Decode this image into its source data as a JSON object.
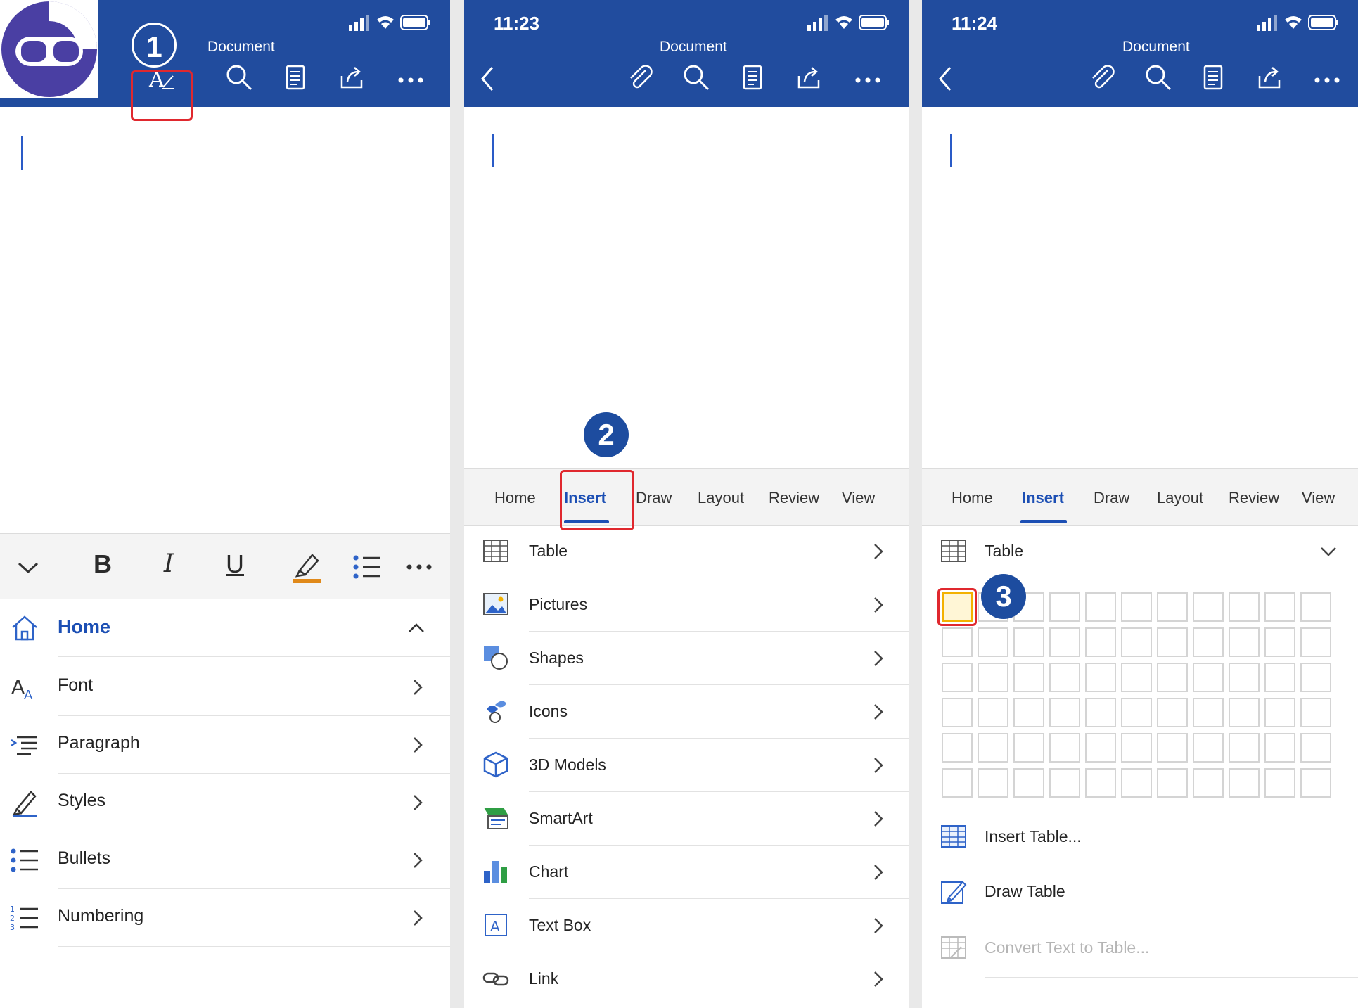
{
  "colors": {
    "brand": "#214c9e",
    "accent": "#1c4fb4",
    "highlight": "#e0282e",
    "badge": "#1d4c9f"
  },
  "panel1": {
    "title": "Document",
    "step": "1",
    "toolbar_icons": [
      "format-text-icon",
      "search-icon",
      "notes-icon",
      "share-icon",
      "more-icon"
    ],
    "format_buttons": [
      "B",
      "I",
      "U"
    ],
    "menu": [
      {
        "label": "Home",
        "icon": "home-icon"
      },
      {
        "label": "Font",
        "icon": "font-icon"
      },
      {
        "label": "Paragraph",
        "icon": "paragraph-icon"
      },
      {
        "label": "Styles",
        "icon": "styles-icon"
      },
      {
        "label": "Bullets",
        "icon": "bullets-icon"
      },
      {
        "label": "Numbering",
        "icon": "numbering-icon"
      }
    ]
  },
  "panel2": {
    "time": "11:23",
    "title": "Document",
    "step": "2",
    "tabs": [
      "Home",
      "Insert",
      "Draw",
      "Layout",
      "Review",
      "View"
    ],
    "active_tab": "Insert",
    "items": [
      {
        "label": "Table",
        "icon": "table-icon"
      },
      {
        "label": "Pictures",
        "icon": "pictures-icon"
      },
      {
        "label": "Shapes",
        "icon": "shapes-icon"
      },
      {
        "label": "Icons",
        "icon": "icons-icon"
      },
      {
        "label": "3D Models",
        "icon": "3d-models-icon"
      },
      {
        "label": "SmartArt",
        "icon": "smartart-icon"
      },
      {
        "label": "Chart",
        "icon": "chart-icon"
      },
      {
        "label": "Text Box",
        "icon": "text-box-icon"
      },
      {
        "label": "Link",
        "icon": "link-icon"
      }
    ]
  },
  "panel3": {
    "time": "11:24",
    "title": "Document",
    "step": "3",
    "tabs": [
      "Home",
      "Insert",
      "Draw",
      "Layout",
      "Review",
      "View"
    ],
    "active_tab": "Insert",
    "table_header": "Table",
    "grid": {
      "cols": 11,
      "rows": 6,
      "selected": [
        1,
        1
      ]
    },
    "actions": [
      {
        "label": "Insert Table...",
        "icon": "insert-table-icon",
        "enabled": true
      },
      {
        "label": "Draw Table",
        "icon": "draw-table-icon",
        "enabled": true
      },
      {
        "label": "Convert Text to Table...",
        "icon": "convert-table-icon",
        "enabled": false
      }
    ]
  }
}
